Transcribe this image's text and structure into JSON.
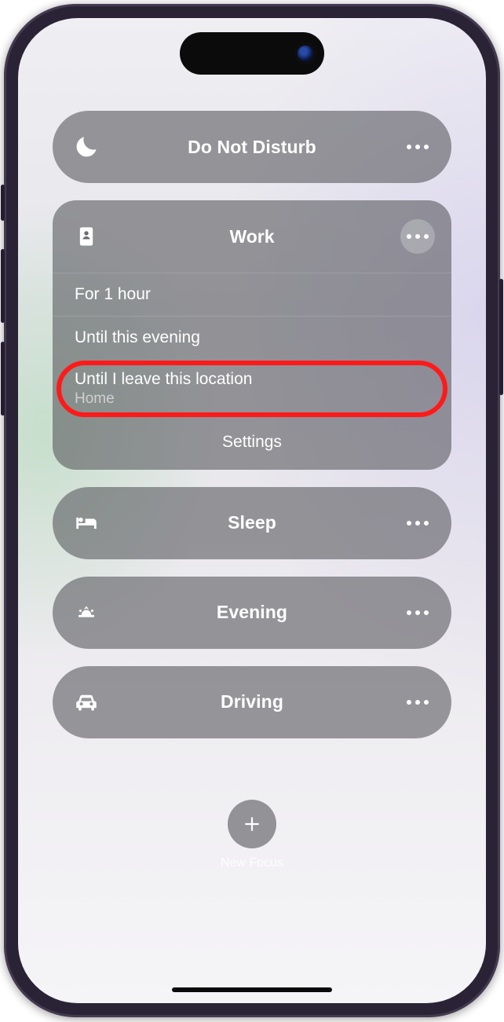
{
  "focus_modes": {
    "dnd": {
      "label": "Do Not Disturb",
      "icon": "moon-icon"
    },
    "work": {
      "label": "Work",
      "icon": "badge-icon"
    },
    "sleep": {
      "label": "Sleep",
      "icon": "bed-icon"
    },
    "evening": {
      "label": "Evening",
      "icon": "sunrise-icon"
    },
    "driving": {
      "label": "Driving",
      "icon": "car-icon"
    }
  },
  "work_options": {
    "opt1": "For 1 hour",
    "opt2": "Until this evening",
    "opt3": {
      "primary": "Until I leave this location",
      "secondary": "Home"
    },
    "settings": "Settings"
  },
  "new_focus": {
    "label": "New Focus"
  },
  "annotation": {
    "highlighted_option": "Until I leave this location"
  }
}
